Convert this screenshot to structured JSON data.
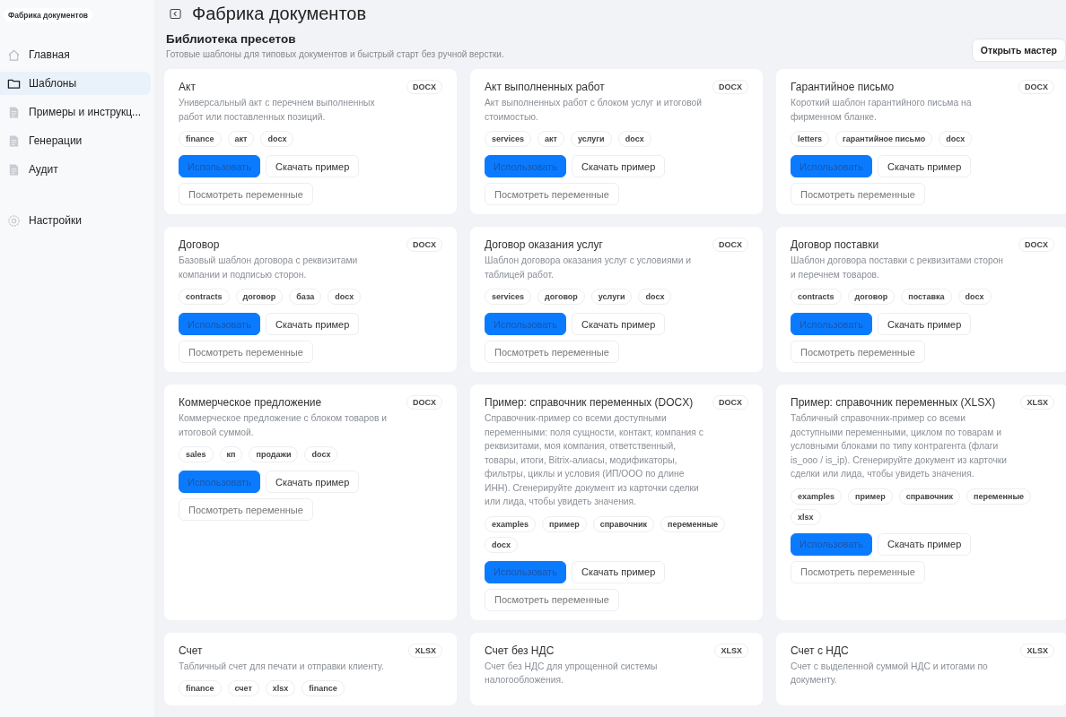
{
  "app_badge": "Фабрика документов",
  "sidebar": {
    "items": [
      {
        "label": "Главная",
        "selected": false
      },
      {
        "label": "Шаблоны",
        "selected": true
      },
      {
        "label": "Примеры и инструкц...",
        "selected": false
      },
      {
        "label": "Генерации",
        "selected": false
      },
      {
        "label": "Аудит",
        "selected": false
      }
    ],
    "footer_items": [
      {
        "label": "Настройки",
        "selected": false
      }
    ]
  },
  "page_title": "Фабрика документов",
  "section": {
    "title": "Библиотека пресетов",
    "subtitle": "Готовые шаблоны для типовых документов и быстрый старт без ручной верстки.",
    "action": "Открыть мастер"
  },
  "cards": [
    {
      "title": "Акт",
      "format": "DOCX",
      "description": "Универсальный акт с перечнем выполненных работ или поставленных позиций.",
      "tags": [
        "finance",
        "акт",
        "docx"
      ],
      "actions": [
        {
          "label": "Использовать",
          "kind": "primary"
        },
        {
          "label": "Скачать пример",
          "kind": "secondary"
        },
        {
          "label": "Посмотреть переменные",
          "kind": "muted"
        }
      ]
    },
    {
      "title": "Акт выполненных работ",
      "format": "DOCX",
      "description": "Акт выполненных работ с блоком услуг и итоговой стоимостью.",
      "tags": [
        "services",
        "акт",
        "услуги",
        "docx"
      ],
      "actions": [
        {
          "label": "Использовать",
          "kind": "primary"
        },
        {
          "label": "Скачать пример",
          "kind": "secondary"
        },
        {
          "label": "Посмотреть переменные",
          "kind": "muted"
        }
      ]
    },
    {
      "title": "Гарантийное письмо",
      "format": "DOCX",
      "description": "Короткий шаблон гарантийного письма на фирменном бланке.",
      "tags": [
        "letters",
        "гарантийное письмо",
        "docx"
      ],
      "actions": [
        {
          "label": "Использовать",
          "kind": "primary"
        },
        {
          "label": "Скачать пример",
          "kind": "secondary"
        },
        {
          "label": "Посмотреть переменные",
          "kind": "muted"
        }
      ]
    },
    {
      "title": "Договор",
      "format": "DOCX",
      "description": "Базовый шаблон договора с реквизитами компании и подписью сторон.",
      "tags": [
        "contracts",
        "договор",
        "база",
        "docx"
      ],
      "actions": [
        {
          "label": "Использовать",
          "kind": "primary"
        },
        {
          "label": "Скачать пример",
          "kind": "secondary"
        },
        {
          "label": "Посмотреть переменные",
          "kind": "muted"
        }
      ]
    },
    {
      "title": "Договор оказания услуг",
      "format": "DOCX",
      "description": "Шаблон договора оказания услуг с условиями и таблицей работ.",
      "tags": [
        "services",
        "договор",
        "услуги",
        "docx"
      ],
      "actions": [
        {
          "label": "Использовать",
          "kind": "primary"
        },
        {
          "label": "Скачать пример",
          "kind": "secondary"
        },
        {
          "label": "Посмотреть переменные",
          "kind": "muted"
        }
      ]
    },
    {
      "title": "Договор поставки",
      "format": "DOCX",
      "description": "Шаблон договора поставки с реквизитами сторон и перечнем товаров.",
      "tags": [
        "contracts",
        "договор",
        "поставка",
        "docx"
      ],
      "actions": [
        {
          "label": "Использовать",
          "kind": "primary"
        },
        {
          "label": "Скачать пример",
          "kind": "secondary"
        },
        {
          "label": "Посмотреть переменные",
          "kind": "muted"
        }
      ]
    },
    {
      "title": "Коммерческое предложение",
      "format": "DOCX",
      "description": "Коммерческое предложение с блоком товаров и итоговой суммой.",
      "tags": [
        "sales",
        "кп",
        "продажи",
        "docx"
      ],
      "actions": [
        {
          "label": "Использовать",
          "kind": "primary"
        },
        {
          "label": "Скачать пример",
          "kind": "secondary"
        },
        {
          "label": "Посмотреть переменные",
          "kind": "muted"
        }
      ]
    },
    {
      "title": "Пример: справочник переменных (DOCX)",
      "format": "DOCX",
      "description": "Справочник-пример со всеми доступными переменными: поля сущности, контакт, компания с реквизитами, моя компания, ответственный, товары, итоги, Bitrix-алиасы, модификаторы, фильтры, циклы и условия (ИП/ООО по длине ИНН). Сгенерируйте документ из карточки сделки или лида, чтобы увидеть значения.",
      "tags": [
        "examples",
        "пример",
        "справочник",
        "переменные",
        "docx"
      ],
      "actions": [
        {
          "label": "Использовать",
          "kind": "primary"
        },
        {
          "label": "Скачать пример",
          "kind": "secondary"
        },
        {
          "label": "Посмотреть переменные",
          "kind": "muted"
        }
      ]
    },
    {
      "title": "Пример: справочник переменных (XLSX)",
      "format": "XLSX",
      "description": "Табличный справочник-пример со всеми доступными переменными, циклом по товарам и условными блоками по типу контрагента (флаги is_ooo / is_ip). Сгенерируйте документ из карточки сделки или лида, чтобы увидеть значения.",
      "tags": [
        "examples",
        "пример",
        "справочник",
        "переменные",
        "xlsx"
      ],
      "actions": [
        {
          "label": "Использовать",
          "kind": "primary"
        },
        {
          "label": "Скачать пример",
          "kind": "secondary"
        },
        {
          "label": "Посмотреть переменные",
          "kind": "muted"
        }
      ]
    },
    {
      "title": "Счет",
      "format": "XLSX",
      "description": "Табличный счет для печати и отправки клиенту.",
      "tags": [
        "finance",
        "счет",
        "xlsx",
        "finance"
      ]
    },
    {
      "title": "Счет без НДС",
      "format": "XLSX",
      "description": "Счет без НДС для упрощенной системы налогообложения."
    },
    {
      "title": "Счет с НДС",
      "format": "XLSX",
      "description": "Счет с выделенной суммой НДС и итогами по документу."
    }
  ]
}
